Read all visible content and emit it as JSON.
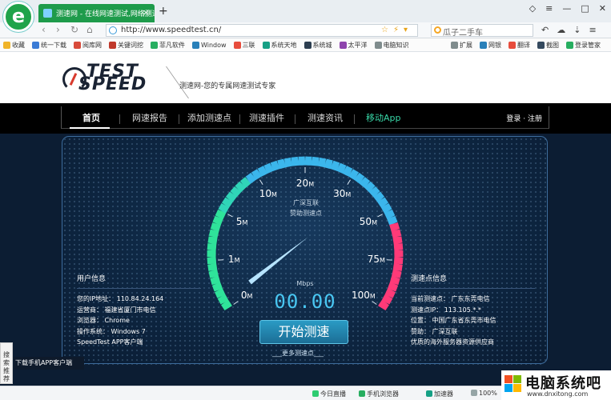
{
  "browser": {
    "tab_title": "测速网 - 在线网速测试,网络测速",
    "url": "http://www.speedtest.cn/",
    "search_text": "瓜子二手车",
    "new_tab": "+",
    "tab_close": "×"
  },
  "bookmarks": {
    "items": [
      {
        "label": "收藏",
        "color": "#f0b429"
      },
      {
        "label": "统一下载",
        "color": "#3a7bd5"
      },
      {
        "label": "阅库网",
        "color": "#d84a3a"
      },
      {
        "label": "关键词挖",
        "color": "#c0392b"
      },
      {
        "label": "菲凡软件",
        "color": "#27ae60"
      },
      {
        "label": "Window",
        "color": "#2980b9"
      },
      {
        "label": "三联",
        "color": "#e74c3c"
      },
      {
        "label": "系统天地",
        "color": "#16a085"
      },
      {
        "label": "系统城",
        "color": "#2c3e50"
      },
      {
        "label": "太平洋",
        "color": "#8e44ad"
      },
      {
        "label": "电脑知识",
        "color": "#7f8c8d"
      }
    ],
    "right": [
      {
        "label": "扩展",
        "color": "#7f8c8d"
      },
      {
        "label": "网银",
        "color": "#2980b9"
      },
      {
        "label": "翻译",
        "color": "#e74c3c"
      },
      {
        "label": "截图",
        "color": "#34495e"
      },
      {
        "label": "登录管家",
        "color": "#27ae60"
      }
    ]
  },
  "site": {
    "brand_top": "TEST",
    "brand_bottom": "SPEED",
    "tagline": "测速网-您的专属网速测试专家",
    "nav": [
      {
        "label": "首页"
      },
      {
        "label": "网速报告"
      },
      {
        "label": "添加测速点"
      },
      {
        "label": "测速插件"
      },
      {
        "label": "测速资讯"
      },
      {
        "label": "移动App"
      }
    ],
    "login": "登录",
    "dot": "·",
    "register": "注册"
  },
  "gauge": {
    "provider": "广深互联",
    "sponsor_text": "赞助测速点",
    "unit": "Mbps",
    "value": "00.00",
    "needle_value": 0,
    "ticks": [
      {
        "label": "0",
        "unit": "M"
      },
      {
        "label": "1",
        "unit": "M"
      },
      {
        "label": "5",
        "unit": "M"
      },
      {
        "label": "10",
        "unit": "M"
      },
      {
        "label": "20",
        "unit": "M"
      },
      {
        "label": "30",
        "unit": "M"
      },
      {
        "label": "50",
        "unit": "M"
      },
      {
        "label": "75",
        "unit": "M"
      },
      {
        "label": "100",
        "unit": "M"
      }
    ]
  },
  "user_info": {
    "title": "用户信息",
    "lines": [
      "您的IP地址： 110.84.24.164",
      "运营商： 福建省厦门市电信",
      "浏览器： Chrome",
      "操作系统： Windows 7"
    ],
    "app_client": "SpeedTest APP客户端"
  },
  "node_info": {
    "title": "测速点信息",
    "lines": [
      "当前测速点： 广东东莞电信",
      "测速点IP： 113.105.*.*",
      "位置： 中国广东省东莞市电信",
      "赞助： 广深互联",
      "优质的海外服务器资源供应商"
    ]
  },
  "start_button": "开始测速",
  "more_nodes": "___更多测速点___",
  "app_banner": "下载手机APP客户端",
  "side_search": [
    "搜",
    "索",
    "推",
    "荐"
  ],
  "status": {
    "today": "今日直播",
    "mobile": "手机浏览器",
    "accel": "加速器",
    "zoom": "100%"
  },
  "watermark": {
    "text": "电脑系统吧",
    "url": "www.dnxitong.com"
  }
}
